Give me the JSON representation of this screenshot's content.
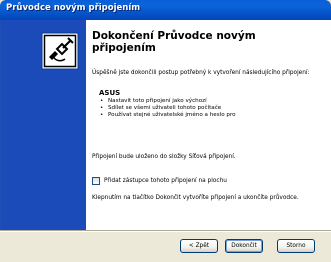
{
  "window": {
    "title": "Průvodce novým připojením"
  },
  "content": {
    "heading": "Dokončení Průvodce novým připojením",
    "intro": "Úspěšně jste dokončili postup potřebný k vytvoření následujícího připojení:",
    "connection_name": "ASUS",
    "bullets": [
      "Nastavit toto připojení jako výchozí",
      "Sdílet se všemi uživateli tohoto počítače",
      "Používat stejné uživatelské jméno a heslo pro"
    ],
    "saved_text": "Připojení bude uloženo do složky Síťová připojení.",
    "shortcut_checkbox": {
      "label": "Přidat zástupce tohoto připojení na plochu",
      "checked": false
    },
    "finish_text": "Klepnutím na tlačítko Dokončit vytvoříte připojení a ukončíte průvodce."
  },
  "buttons": {
    "back": "< Zpět",
    "finish": "Dokončit",
    "cancel": "Storno"
  },
  "icons": {
    "wizard": "network-connection-icon"
  },
  "colors": {
    "titlebar": "#0552c8",
    "side_panel": "#1a4bb8",
    "dialog_bg": "#ece9d8"
  }
}
